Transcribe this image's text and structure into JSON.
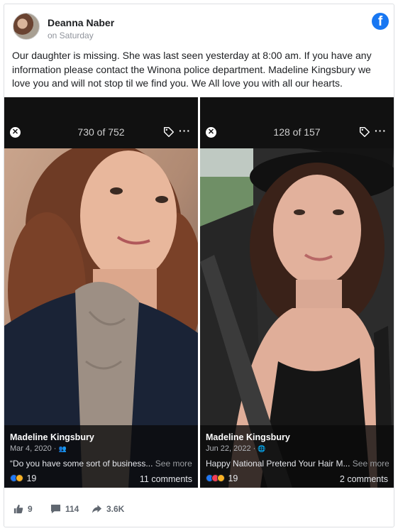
{
  "post": {
    "author": "Deanna Naber",
    "time": "on Saturday",
    "text": "Our daughter is missing. She was last seen yesterday at 8:00 am. If you have any information please contact the Winona police department. Madeline Kingsbury we love you and will not stop til we find you. We All love you with all our hearts."
  },
  "viewers": [
    {
      "counter": "730 of 752",
      "name": "Madeline Kingsbury",
      "date": "Mar 4, 2020 ·",
      "caption": "“Do you have some sort of business...",
      "see_more": "See more",
      "reactions": "19",
      "comments": "11 comments"
    },
    {
      "counter": "128 of 157",
      "name": "Madeline Kingsbury",
      "date": "Jun 22, 2022 ·",
      "caption": "Happy National Pretend Your Hair M...",
      "see_more": "See more",
      "reactions": "19",
      "comments": "2 comments"
    }
  ],
  "footer": {
    "likes": "9",
    "comments": "114",
    "shares": "3.6K"
  },
  "colors": {
    "facebook_blue": "#1877f2",
    "like_blue": "#2078f4",
    "love_red": "#f33e58",
    "haha_yellow": "#f7b125"
  }
}
